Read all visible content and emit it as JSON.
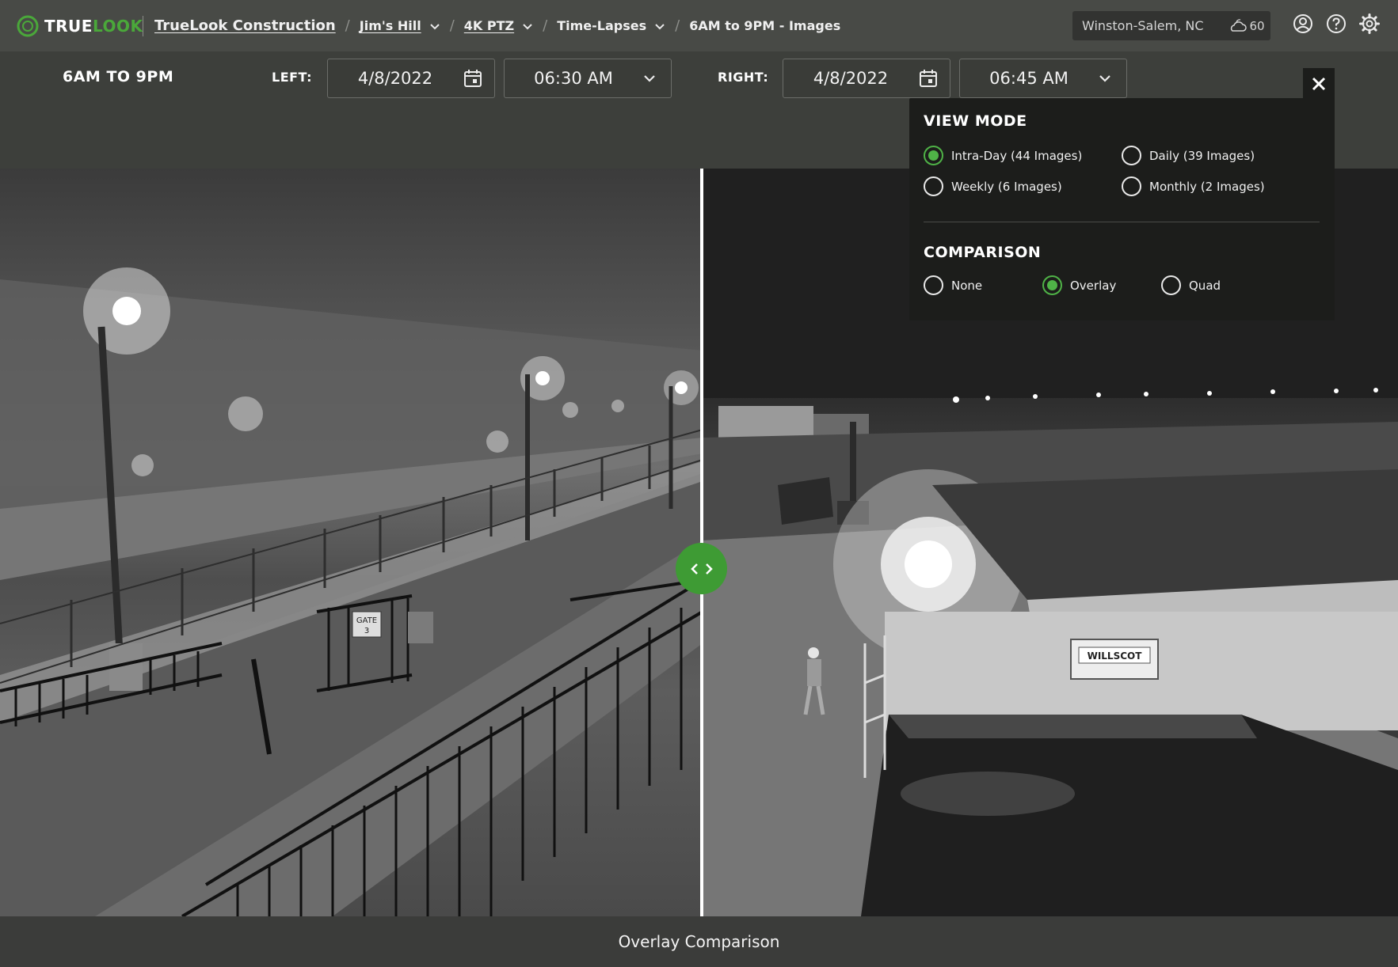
{
  "brand": {
    "word1": "TRUE",
    "word2": "LOOK",
    "accent": "#4aa83a"
  },
  "breadcrumb": [
    {
      "label": "TrueLook Construction",
      "link": true,
      "dropdown": false
    },
    {
      "label": "Jim's Hill",
      "link": true,
      "dropdown": true
    },
    {
      "label": "4K PTZ",
      "link": true,
      "dropdown": true
    },
    {
      "label": "Time-Lapses",
      "link": false,
      "dropdown": true
    },
    {
      "label": "6AM to 9PM - Images",
      "link": false,
      "dropdown": false
    }
  ],
  "location": {
    "city": "Winston-Salem, NC",
    "weather_icon": "cloudy-night-icon",
    "temp": "60"
  },
  "header_icons": [
    "account-icon",
    "help-icon",
    "settings-icon"
  ],
  "toolbar": {
    "title": "6AM TO 9PM",
    "left_label": "LEFT:",
    "left_date": "4/8/2022",
    "left_time": "06:30 AM",
    "right_label": "RIGHT:",
    "right_date": "4/8/2022",
    "right_time": "06:45 AM"
  },
  "popover": {
    "view_mode_title": "VIEW MODE",
    "view_modes": [
      {
        "label": "Intra-Day (44 Images)",
        "selected": true
      },
      {
        "label": "Daily (39 Images)",
        "selected": false
      },
      {
        "label": "Weekly (6 Images)",
        "selected": false
      },
      {
        "label": "Monthly (2 Images)",
        "selected": false
      }
    ],
    "comparison_title": "COMPARISON",
    "comparisons": [
      {
        "label": "None",
        "selected": false
      },
      {
        "label": "Overlay",
        "selected": true
      },
      {
        "label": "Quad",
        "selected": false
      }
    ]
  },
  "footer": {
    "label": "Overlay Comparison"
  },
  "scene": {
    "gate_sign_line1": "GATE",
    "gate_sign_line2": "3",
    "trailer_sign": "WILLSCOT"
  }
}
